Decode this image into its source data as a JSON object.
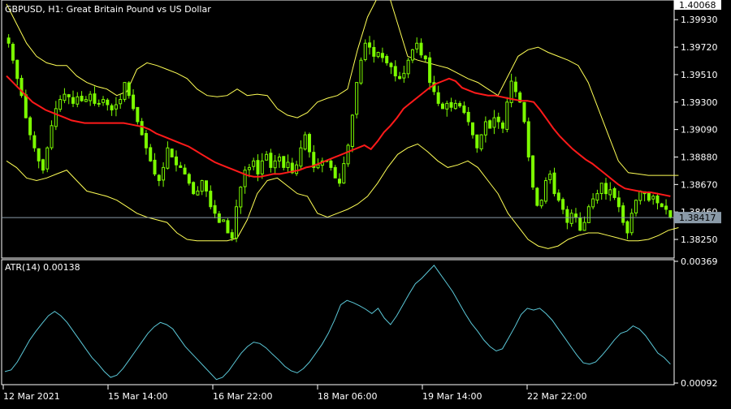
{
  "chart_data": [
    {
      "type": "candlestick",
      "title": "GBPUSD, H1:  Great Britain Pound vs US Dollar",
      "symbol": "GBPUSD",
      "timeframe": "H1",
      "description": "Great Britain Pound vs US Dollar",
      "ylim": [
        1.3812,
        1.40068
      ],
      "y_ticks": [
        "1.40068",
        "1.39930",
        "1.39720",
        "1.39510",
        "1.39300",
        "1.39090",
        "1.38880",
        "1.38670",
        "1.38460",
        "1.38250"
      ],
      "top_price_label": "1.40068",
      "current_price": 1.38417,
      "current_price_label": "1.38417",
      "x_ticks": [
        "12 Mar 2021",
        "15 Mar 14:00",
        "16 Mar 22:00",
        "18 Mar 06:00",
        "19 Mar 14:00",
        "22 Mar 22:00"
      ],
      "close": [
        1.3975,
        1.3962,
        1.3948,
        1.3935,
        1.3918,
        1.3905,
        1.3895,
        1.3885,
        1.3878,
        1.3895,
        1.3912,
        1.3925,
        1.3932,
        1.3936,
        1.3934,
        1.3929,
        1.3934,
        1.3931,
        1.3932,
        1.3936,
        1.3929,
        1.3929,
        1.3932,
        1.3928,
        1.3924,
        1.3928,
        1.3932,
        1.3945,
        1.3935,
        1.3925,
        1.3915,
        1.3905,
        1.3895,
        1.3885,
        1.3875,
        1.387,
        1.388,
        1.3895,
        1.3888,
        1.3882,
        1.388,
        1.3875,
        1.3868,
        1.386,
        1.3862,
        1.387,
        1.3862,
        1.385,
        1.3845,
        1.3838,
        1.384,
        1.383,
        1.3826,
        1.385,
        1.3865,
        1.3878,
        1.388,
        1.3885,
        1.3875,
        1.3885,
        1.389,
        1.388,
        1.3885,
        1.3888,
        1.388,
        1.3884,
        1.3876,
        1.3882,
        1.3895,
        1.3905,
        1.3892,
        1.388,
        1.3882,
        1.3885,
        1.3885,
        1.388,
        1.3872,
        1.3868,
        1.3883,
        1.3897,
        1.392,
        1.3945,
        1.3962,
        1.3975,
        1.3972,
        1.3965,
        1.3968,
        1.3964,
        1.396,
        1.3957,
        1.395,
        1.3948,
        1.3952,
        1.3962,
        1.397,
        1.3975,
        1.3966,
        1.3963,
        1.3945,
        1.3938,
        1.3929,
        1.3925,
        1.3929,
        1.3926,
        1.3929,
        1.3927,
        1.3922,
        1.3915,
        1.3905,
        1.3895,
        1.3905,
        1.3915,
        1.391,
        1.3918,
        1.3915,
        1.391,
        1.393,
        1.3946,
        1.3938,
        1.393,
        1.3915,
        1.3888,
        1.3865,
        1.3851,
        1.3855,
        1.387,
        1.3875,
        1.386,
        1.3855,
        1.3848,
        1.3838,
        1.3845,
        1.3842,
        1.3832,
        1.3838,
        1.385,
        1.3856,
        1.386,
        1.3868,
        1.386,
        1.3863,
        1.3857,
        1.385,
        1.3838,
        1.383,
        1.3845,
        1.3855,
        1.3862,
        1.386,
        1.3855,
        1.3858,
        1.3853,
        1.385,
        1.3848,
        1.3842
      ],
      "ma": [
        1.395,
        1.3945,
        1.394,
        1.3935,
        1.393,
        1.3927,
        1.3924,
        1.3922,
        1.392,
        1.3918,
        1.3916,
        1.3915,
        1.3914,
        1.3914,
        1.3914,
        1.3914,
        1.3914,
        1.3914,
        1.3914,
        1.3913,
        1.3912,
        1.3911,
        1.3909,
        1.3906,
        1.3904,
        1.3902,
        1.39,
        1.3898,
        1.3896,
        1.3893,
        1.389,
        1.3887,
        1.3884,
        1.3882,
        1.388,
        1.3878,
        1.3876,
        1.3874,
        1.3873,
        1.3873,
        1.3874,
        1.3875,
        1.3875,
        1.3876,
        1.3877,
        1.3878,
        1.388,
        1.3881,
        1.3883,
        1.3885,
        1.3887,
        1.3889,
        1.3891,
        1.3893,
        1.3895,
        1.3897,
        1.3894,
        1.39,
        1.3907,
        1.3912,
        1.3918,
        1.3925,
        1.3929,
        1.3933,
        1.3937,
        1.3941,
        1.3944,
        1.3946,
        1.3948,
        1.3946,
        1.3941,
        1.3939,
        1.3937,
        1.3936,
        1.3935,
        1.3935,
        1.3934,
        1.3933,
        1.3932,
        1.3931,
        1.3931,
        1.393,
        1.3924,
        1.3917,
        1.391,
        1.3904,
        1.3899,
        1.3894,
        1.389,
        1.3886,
        1.3883,
        1.3879,
        1.3875,
        1.3871,
        1.3867,
        1.3864,
        1.3863,
        1.3862,
        1.3861,
        1.3861,
        1.386,
        1.3859,
        1.3858
      ],
      "ma_start_index": 0,
      "bb_upper": [
        1.4005,
        1.399,
        1.3975,
        1.3965,
        1.396,
        1.3958,
        1.3958,
        1.395,
        1.3945,
        1.3942,
        1.394,
        1.3935,
        1.3938,
        1.3955,
        1.396,
        1.3958,
        1.3955,
        1.3952,
        1.3948,
        1.394,
        1.3935,
        1.3934,
        1.3935,
        1.394,
        1.3935,
        1.3936,
        1.3935,
        1.3925,
        1.392,
        1.3918,
        1.3922,
        1.393,
        1.3933,
        1.3935,
        1.394,
        1.397,
        1.3995,
        1.401,
        1.4015,
        1.399,
        1.3965,
        1.3962,
        1.396,
        1.3958,
        1.3956,
        1.3952,
        1.3948,
        1.3945,
        1.394,
        1.3935,
        1.395,
        1.3965,
        1.397,
        1.3972,
        1.3968,
        1.3965,
        1.3962,
        1.3958,
        1.3945,
        1.3925,
        1.3905,
        1.3885,
        1.3876,
        1.3875,
        1.3874,
        1.3874,
        1.3874,
        1.3874
      ],
      "bb_lower": [
        1.3885,
        1.388,
        1.3872,
        1.387,
        1.3872,
        1.3875,
        1.3878,
        1.387,
        1.3862,
        1.386,
        1.3858,
        1.3855,
        1.385,
        1.3845,
        1.3842,
        1.384,
        1.3838,
        1.383,
        1.3825,
        1.3824,
        1.3824,
        1.3824,
        1.3824,
        1.3826,
        1.384,
        1.386,
        1.387,
        1.3872,
        1.3866,
        1.386,
        1.3858,
        1.3845,
        1.3842,
        1.3845,
        1.3848,
        1.3852,
        1.3858,
        1.3868,
        1.388,
        1.389,
        1.3895,
        1.3898,
        1.3892,
        1.3885,
        1.388,
        1.3882,
        1.3885,
        1.388,
        1.387,
        1.386,
        1.3845,
        1.3835,
        1.3825,
        1.382,
        1.3818,
        1.382,
        1.3825,
        1.3828,
        1.383,
        1.383,
        1.3828,
        1.3826,
        1.3824,
        1.3824,
        1.3825,
        1.3828,
        1.3832,
        1.3834
      ],
      "colors": {
        "candle": "#7CFC00",
        "ma": "#FF1A1A",
        "bands": "#FFFF55",
        "atr": "#5BC8D8",
        "grid_line": "#8A9AA8",
        "axis": "#FFFFFF",
        "price_badge": "#8A9AA8"
      }
    },
    {
      "type": "line",
      "title": "ATR(14) 0.00138",
      "ylim": [
        0.00092,
        0.00369
      ],
      "y_ticks": [
        "0.00369",
        "0.00092"
      ],
      "series": [
        {
          "name": "ATR(14)",
          "values": [
            0.00118,
            0.00122,
            0.0014,
            0.00165,
            0.0019,
            0.0021,
            0.00228,
            0.00245,
            0.00255,
            0.00245,
            0.0023,
            0.0021,
            0.0019,
            0.0017,
            0.0015,
            0.00135,
            0.00118,
            0.00105,
            0.0011,
            0.00125,
            0.00145,
            0.00165,
            0.00185,
            0.00205,
            0.0022,
            0.0023,
            0.00225,
            0.00215,
            0.00195,
            0.00175,
            0.0016,
            0.00145,
            0.0013,
            0.00115,
            0.001,
            0.00105,
            0.0012,
            0.0014,
            0.0016,
            0.00175,
            0.00185,
            0.00182,
            0.00172,
            0.00158,
            0.00145,
            0.0013,
            0.0012,
            0.00115,
            0.00125,
            0.0014,
            0.0016,
            0.0018,
            0.00205,
            0.00235,
            0.0027,
            0.0028,
            0.00275,
            0.00268,
            0.0026,
            0.0025,
            0.00262,
            0.0024,
            0.00225,
            0.00245,
            0.0027,
            0.00295,
            0.00318,
            0.0033,
            0.00345,
            0.0036,
            0.0034,
            0.0032,
            0.003,
            0.00275,
            0.0025,
            0.00228,
            0.0021,
            0.0019,
            0.00175,
            0.00165,
            0.0017,
            0.00195,
            0.0022,
            0.00248,
            0.00262,
            0.00258,
            0.00262,
            0.0025,
            0.00235,
            0.00215,
            0.00195,
            0.00175,
            0.00155,
            0.00138,
            0.00135,
            0.0014,
            0.00155,
            0.00172,
            0.0019,
            0.00205,
            0.0021,
            0.00222,
            0.00215,
            0.002,
            0.0018,
            0.0016,
            0.0015,
            0.00135
          ]
        }
      ]
    }
  ]
}
